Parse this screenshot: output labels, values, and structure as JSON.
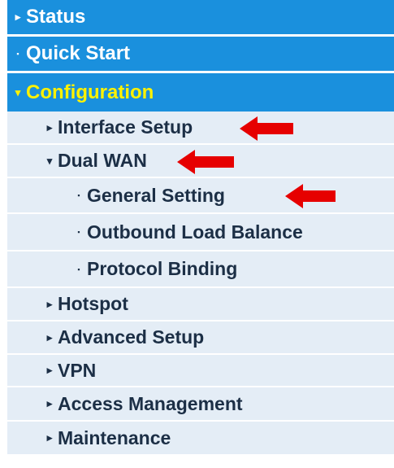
{
  "menu": {
    "status": "Status",
    "quick_start": "Quick Start",
    "configuration": "Configuration",
    "interface_setup": "Interface Setup",
    "dual_wan": "Dual WAN",
    "general_setting": "General Setting",
    "outbound_load_balance": "Outbound Load Balance",
    "protocol_binding": "Protocol Binding",
    "hotspot": "Hotspot",
    "advanced_setup": "Advanced Setup",
    "vpn": "VPN",
    "access_management": "Access Management",
    "maintenance": "Maintenance"
  },
  "colors": {
    "header_blue": "#1a90dd",
    "config_yellow": "#fff200",
    "submenu_bg": "#e4edf6",
    "annotation_arrow": "#e60000"
  },
  "icons": {
    "collapsed": "triangle-right-icon",
    "expanded": "triangle-down-icon",
    "leaf": "bullet-dot-icon",
    "annotation": "red-left-arrow-icon"
  }
}
